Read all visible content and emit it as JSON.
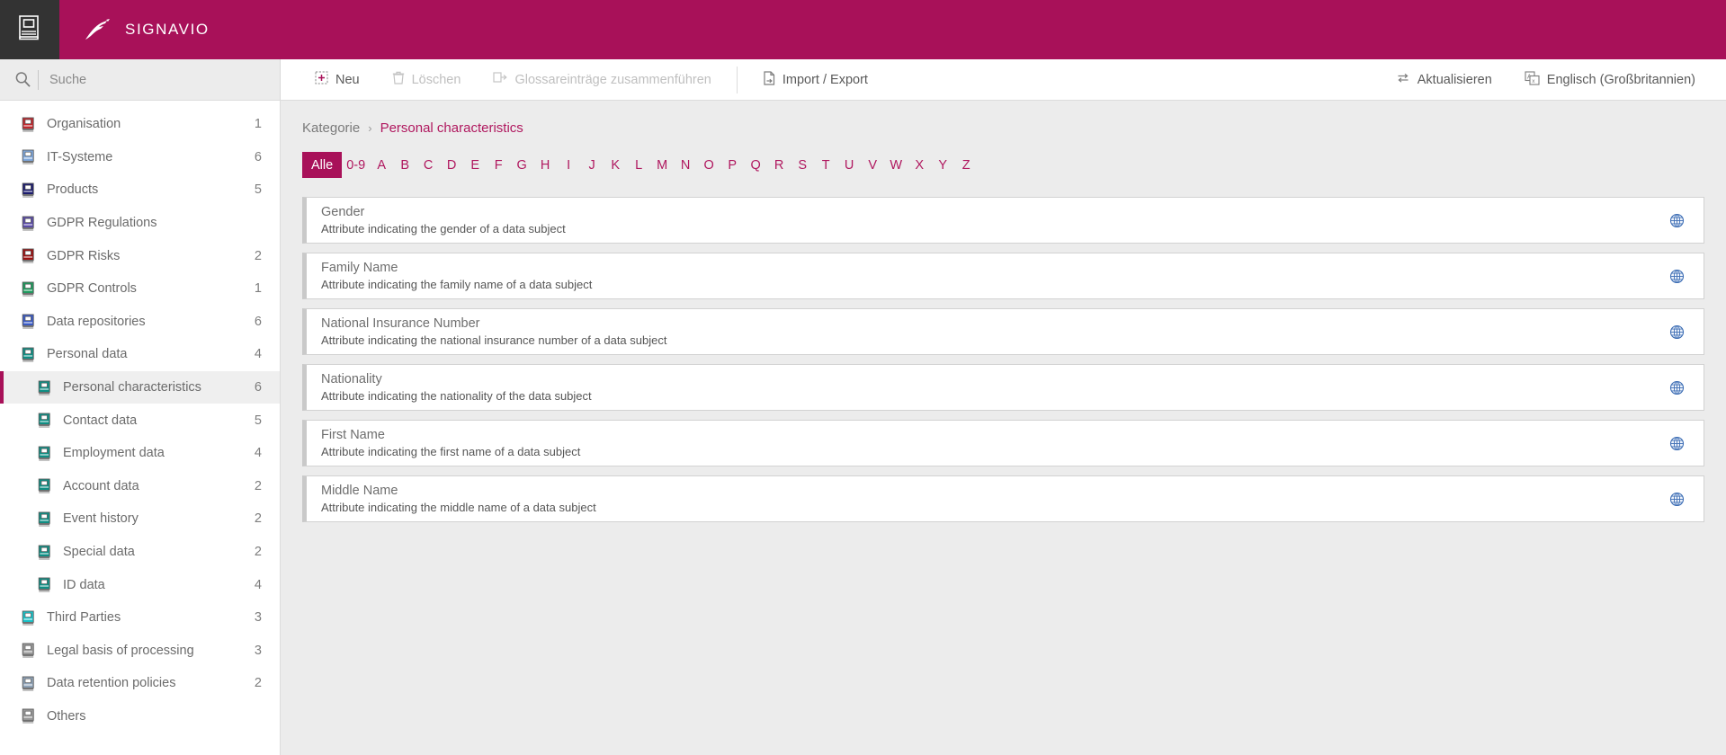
{
  "brand": {
    "name": "SIGNAVIO",
    "color": "#A81159",
    "app_tile_icon": "book-icon",
    "logo_icon": "signavio-gazelle-logo"
  },
  "search": {
    "placeholder": "Suche",
    "value": "",
    "icon": "search-icon"
  },
  "toolbar": {
    "left_actions": [
      {
        "label": "Neu",
        "icon": "plus-box-icon",
        "disabled": false
      },
      {
        "label": "Löschen",
        "icon": "trash-icon",
        "disabled": true
      },
      {
        "label": "Glossareinträge zusammenführen",
        "icon": "merge-icon",
        "disabled": true
      }
    ],
    "import_export": {
      "label": "Import / Export",
      "icon": "document-export-icon",
      "disabled": false
    },
    "right_actions": [
      {
        "label": "Aktualisieren",
        "icon": "refresh-icon",
        "disabled": false
      },
      {
        "label": "Englisch (Großbritannien)",
        "icon": "translate-icon",
        "disabled": false
      }
    ]
  },
  "sidebar": {
    "items": [
      {
        "label": "Organisation",
        "count": "1",
        "icon": "book-icon",
        "color": "#C0272D",
        "child": false,
        "selected": false
      },
      {
        "label": "IT-Systeme",
        "count": "6",
        "icon": "book-icon",
        "color": "#7FA8DC",
        "child": false,
        "selected": false
      },
      {
        "label": "Products",
        "count": "5",
        "icon": "book-icon",
        "color": "#1B1B6E",
        "child": false,
        "selected": false
      },
      {
        "label": "GDPR Regulations",
        "count": "",
        "icon": "book-icon",
        "color": "#5B4BA8",
        "child": false,
        "selected": false
      },
      {
        "label": "GDPR Risks",
        "count": "2",
        "icon": "book-icon",
        "color": "#9B1010",
        "child": false,
        "selected": false
      },
      {
        "label": "GDPR Controls",
        "count": "1",
        "icon": "book-icon",
        "color": "#1E9B5E",
        "child": false,
        "selected": false
      },
      {
        "label": "Data repositories",
        "count": "6",
        "icon": "book-icon",
        "color": "#3A5BC7",
        "child": false,
        "selected": false
      },
      {
        "label": "Personal data",
        "count": "4",
        "icon": "book-icon",
        "color": "#0E8F84",
        "child": false,
        "selected": false
      },
      {
        "label": "Personal characteristics",
        "count": "6",
        "icon": "book-icon",
        "color": "#0E8F84",
        "child": true,
        "selected": true
      },
      {
        "label": "Contact data",
        "count": "5",
        "icon": "book-icon",
        "color": "#0E8F84",
        "child": true,
        "selected": false
      },
      {
        "label": "Employment data",
        "count": "4",
        "icon": "book-icon",
        "color": "#0E8F84",
        "child": true,
        "selected": false
      },
      {
        "label": "Account data",
        "count": "2",
        "icon": "book-icon",
        "color": "#0E8F84",
        "child": true,
        "selected": false
      },
      {
        "label": "Event history",
        "count": "2",
        "icon": "book-icon",
        "color": "#0E8F84",
        "child": true,
        "selected": false
      },
      {
        "label": "Special data",
        "count": "2",
        "icon": "book-icon",
        "color": "#0E8F84",
        "child": true,
        "selected": false
      },
      {
        "label": "ID data",
        "count": "4",
        "icon": "book-icon",
        "color": "#0E8F84",
        "child": true,
        "selected": false
      },
      {
        "label": "Third Parties",
        "count": "3",
        "icon": "book-icon",
        "color": "#19C3C9",
        "child": false,
        "selected": false
      },
      {
        "label": "Legal basis of processing",
        "count": "3",
        "icon": "book-icon",
        "color": "#9A9A9A",
        "child": false,
        "selected": false
      },
      {
        "label": "Data retention policies",
        "count": "2",
        "icon": "book-icon",
        "color": "#8FA3B8",
        "child": false,
        "selected": false
      },
      {
        "label": "Others",
        "count": "",
        "icon": "book-icon",
        "color": "#9A9A9A",
        "child": false,
        "selected": false
      }
    ]
  },
  "breadcrumb": {
    "root": "Kategorie",
    "separator": "›",
    "current": "Personal characteristics"
  },
  "alphabet_filter": {
    "active": "Alle",
    "items": [
      "Alle",
      "0-9",
      "A",
      "B",
      "C",
      "D",
      "E",
      "F",
      "G",
      "H",
      "I",
      "J",
      "K",
      "L",
      "M",
      "N",
      "O",
      "P",
      "Q",
      "R",
      "S",
      "T",
      "U",
      "V",
      "W",
      "X",
      "Y",
      "Z"
    ]
  },
  "glossary_entries": [
    {
      "title": "Gender",
      "description": "Attribute indicating the gender of a data subject",
      "icon": "globe-icon"
    },
    {
      "title": "Family Name",
      "description": "Attribute indicating the family name of a data subject",
      "icon": "globe-icon"
    },
    {
      "title": "National Insurance Number",
      "description": "Attribute indicating the national insurance number of a data subject",
      "icon": "globe-icon"
    },
    {
      "title": "Nationality",
      "description": "Attribute indicating the nationality of the data subject",
      "icon": "globe-icon"
    },
    {
      "title": "First Name",
      "description": "Attribute indicating the first name of a data subject",
      "icon": "globe-icon"
    },
    {
      "title": "Middle Name",
      "description": "Attribute indicating the middle name of a data subject",
      "icon": "globe-icon"
    }
  ]
}
